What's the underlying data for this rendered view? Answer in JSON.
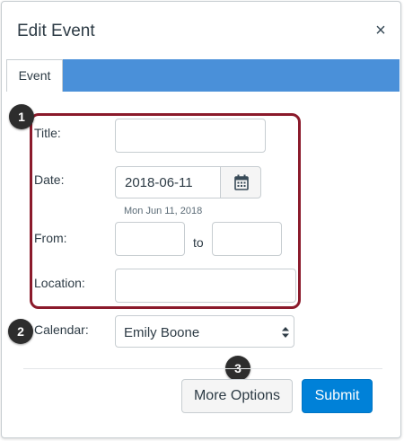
{
  "dialog": {
    "title": "Edit Event",
    "close_glyph": "×"
  },
  "tabs": [
    {
      "label": "Event"
    }
  ],
  "callouts": {
    "one": "1",
    "two": "2",
    "three": "3"
  },
  "form": {
    "title_label": "Title:",
    "title_value": "",
    "date_label": "Date:",
    "date_value": "2018-06-11",
    "date_helper": "Mon Jun 11, 2018",
    "from_label": "From:",
    "from_value": "",
    "to_label": "to",
    "to_value": "",
    "location_label": "Location:",
    "location_value": "",
    "calendar_label": "Calendar:",
    "calendar_value": "Emily Boone"
  },
  "footer": {
    "more_options_label": "More Options",
    "submit_label": "Submit"
  },
  "colors": {
    "tab_bar": "#4a90d9",
    "highlight_frame": "#8b1a2b",
    "submit": "#0081d8",
    "callout": "#2d2d2d"
  }
}
